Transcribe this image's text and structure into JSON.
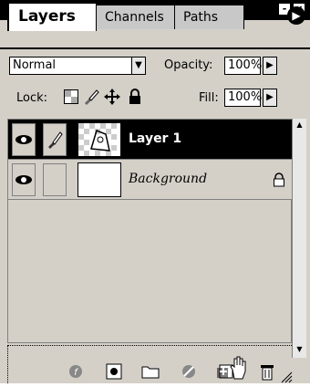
{
  "tabs": [
    "Layers",
    "Channels",
    "Paths"
  ],
  "blend": {
    "mode": "Normal",
    "opacity_label": "Opacity:",
    "opacity_value": "100%"
  },
  "lock": {
    "label": "Lock:",
    "fill_label": "Fill:",
    "fill_value": "100%"
  },
  "layers": [
    {
      "name": "Layer 1",
      "selected": true,
      "visible": true,
      "has_brush": true
    },
    {
      "name": "Background",
      "selected": false,
      "visible": true,
      "locked": true
    }
  ],
  "window_buttons": {
    "minimize": "-",
    "close": "x"
  },
  "colors": {
    "selected_row": "#000000",
    "panel": "#d4d0c8"
  }
}
